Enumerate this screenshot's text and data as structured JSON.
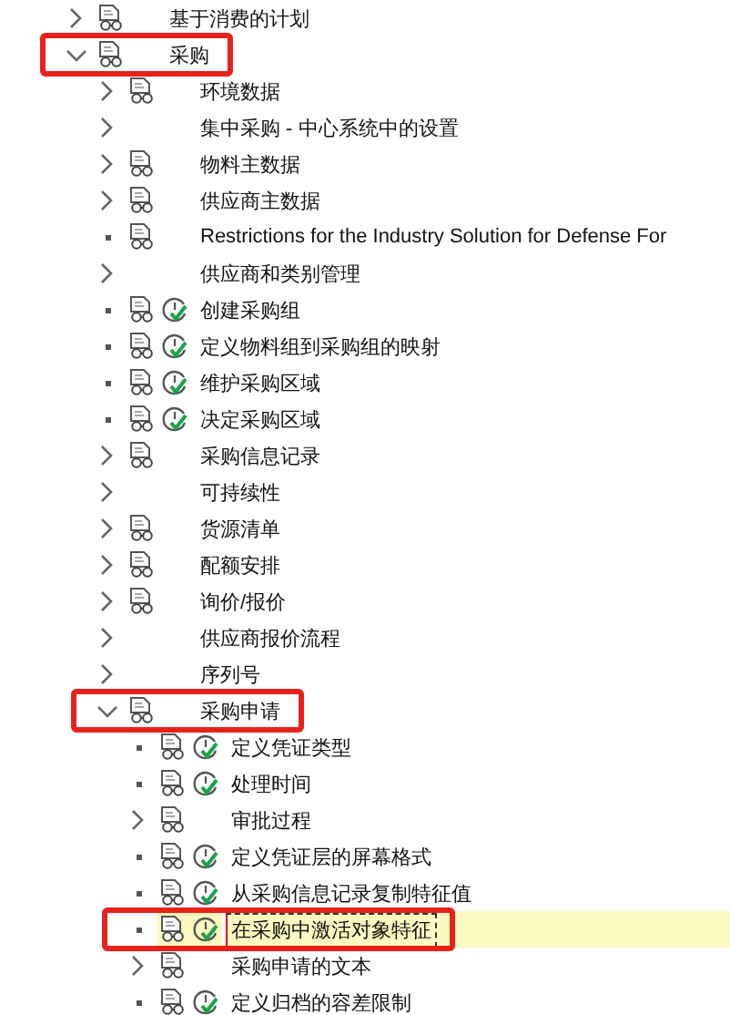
{
  "tree": [
    {
      "label": "基于消费的计划",
      "kind": "node",
      "expanded": false,
      "doc_icon": true,
      "activity_icon": false,
      "selected": false,
      "marked": false
    },
    {
      "label": "采购",
      "kind": "node",
      "expanded": true,
      "doc_icon": true,
      "activity_icon": false,
      "selected": false,
      "marked": true,
      "children": [
        {
          "label": "环境数据",
          "kind": "node",
          "expanded": false,
          "doc_icon": true,
          "activity_icon": false,
          "selected": false,
          "marked": false
        },
        {
          "label": "集中采购 - 中心系统中的设置",
          "kind": "node",
          "expanded": false,
          "doc_icon": false,
          "activity_icon": false,
          "selected": false,
          "marked": false
        },
        {
          "label": "物料主数据",
          "kind": "node",
          "expanded": false,
          "doc_icon": true,
          "activity_icon": false,
          "selected": false,
          "marked": false
        },
        {
          "label": "供应商主数据",
          "kind": "node",
          "expanded": false,
          "doc_icon": true,
          "activity_icon": false,
          "selected": false,
          "marked": false
        },
        {
          "label": "Restrictions for the Industry Solution for Defense For",
          "kind": "leaf",
          "doc_icon": true,
          "activity_icon": false,
          "selected": false,
          "marked": false
        },
        {
          "label": "供应商和类别管理",
          "kind": "node",
          "expanded": false,
          "doc_icon": false,
          "activity_icon": false,
          "selected": false,
          "marked": false
        },
        {
          "label": "创建采购组",
          "kind": "leaf",
          "doc_icon": true,
          "activity_icon": true,
          "selected": false,
          "marked": false
        },
        {
          "label": "定义物料组到采购组的映射",
          "kind": "leaf",
          "doc_icon": true,
          "activity_icon": true,
          "selected": false,
          "marked": false
        },
        {
          "label": "维护采购区域",
          "kind": "leaf",
          "doc_icon": true,
          "activity_icon": true,
          "selected": false,
          "marked": false
        },
        {
          "label": "决定采购区域",
          "kind": "leaf",
          "doc_icon": true,
          "activity_icon": true,
          "selected": false,
          "marked": false
        },
        {
          "label": "采购信息记录",
          "kind": "node",
          "expanded": false,
          "doc_icon": true,
          "activity_icon": false,
          "selected": false,
          "marked": false
        },
        {
          "label": "可持续性",
          "kind": "node",
          "expanded": false,
          "doc_icon": false,
          "activity_icon": false,
          "selected": false,
          "marked": false
        },
        {
          "label": "货源清单",
          "kind": "node",
          "expanded": false,
          "doc_icon": true,
          "activity_icon": false,
          "selected": false,
          "marked": false
        },
        {
          "label": "配额安排",
          "kind": "node",
          "expanded": false,
          "doc_icon": true,
          "activity_icon": false,
          "selected": false,
          "marked": false
        },
        {
          "label": "询价/报价",
          "kind": "node",
          "expanded": false,
          "doc_icon": true,
          "activity_icon": false,
          "selected": false,
          "marked": false
        },
        {
          "label": "供应商报价流程",
          "kind": "node",
          "expanded": false,
          "doc_icon": false,
          "activity_icon": false,
          "selected": false,
          "marked": false
        },
        {
          "label": "序列号",
          "kind": "node",
          "expanded": false,
          "doc_icon": false,
          "activity_icon": false,
          "selected": false,
          "marked": false
        },
        {
          "label": "采购申请",
          "kind": "node",
          "expanded": true,
          "doc_icon": true,
          "activity_icon": false,
          "selected": false,
          "marked": true,
          "children": [
            {
              "label": "定义凭证类型",
              "kind": "leaf",
              "doc_icon": true,
              "activity_icon": true,
              "selected": false,
              "marked": false
            },
            {
              "label": "处理时间",
              "kind": "leaf",
              "doc_icon": true,
              "activity_icon": true,
              "selected": false,
              "marked": false
            },
            {
              "label": "审批过程",
              "kind": "node",
              "expanded": false,
              "doc_icon": true,
              "activity_icon": false,
              "selected": false,
              "marked": false
            },
            {
              "label": "定义凭证层的屏幕格式",
              "kind": "leaf",
              "doc_icon": true,
              "activity_icon": true,
              "selected": false,
              "marked": false
            },
            {
              "label": "从采购信息记录复制特征值",
              "kind": "leaf",
              "doc_icon": true,
              "activity_icon": true,
              "selected": false,
              "marked": false
            },
            {
              "label": "在采购中激活对象特征",
              "kind": "leaf",
              "doc_icon": true,
              "activity_icon": true,
              "selected": true,
              "marked": true
            },
            {
              "label": "采购申请的文本",
              "kind": "node",
              "expanded": false,
              "doc_icon": true,
              "activity_icon": false,
              "selected": false,
              "marked": false
            },
            {
              "label": "定义归档的容差限制",
              "kind": "leaf",
              "doc_icon": true,
              "activity_icon": true,
              "selected": false,
              "marked": false
            }
          ]
        }
      ]
    }
  ]
}
